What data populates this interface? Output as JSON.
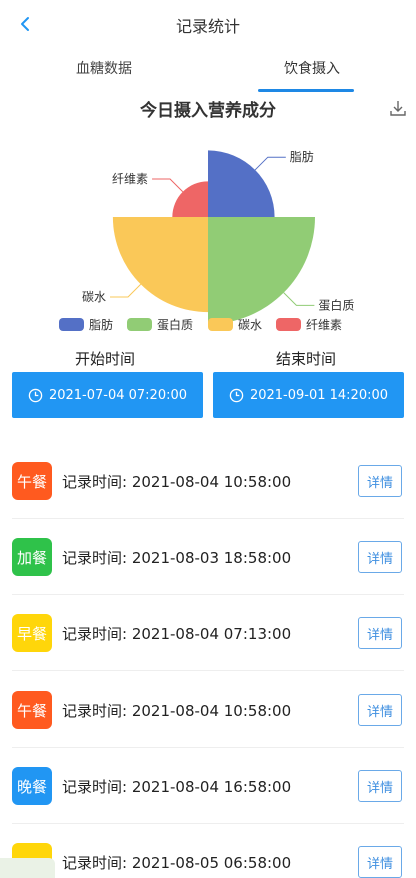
{
  "header": {
    "title": "记录统计"
  },
  "tabs": [
    {
      "label": "血糖数据"
    },
    {
      "label": "饮食摄入"
    }
  ],
  "chart_data": {
    "type": "pie",
    "variant": "rose",
    "title": "今日摄入营养成分",
    "legend_position": "bottom",
    "series": [
      {
        "name": "脂肪",
        "value": 28,
        "color": "#5470c6"
      },
      {
        "name": "蛋白质",
        "value": 45,
        "color": "#91cc75"
      },
      {
        "name": "碳水",
        "value": 40,
        "color": "#fac858"
      },
      {
        "name": "纤维素",
        "value": 15,
        "color": "#ee6666"
      }
    ]
  },
  "range": {
    "start_label": "开始时间",
    "end_label": "结束时间",
    "start_value": "2021-07-04 07:20:00",
    "end_value": "2021-09-01 14:20:00"
  },
  "records": [
    {
      "meal": "午餐",
      "color": "#ff5a1f",
      "text": "记录时间: 2021-08-04 10:58:00",
      "detail": "详情"
    },
    {
      "meal": "加餐",
      "color": "#2fc24a",
      "text": "记录时间: 2021-08-03 18:58:00",
      "detail": "详情"
    },
    {
      "meal": "早餐",
      "color": "#ffd60a",
      "text": "记录时间: 2021-08-04 07:13:00",
      "detail": "详情"
    },
    {
      "meal": "午餐",
      "color": "#ff5a1f",
      "text": "记录时间: 2021-08-04 10:58:00",
      "detail": "详情"
    },
    {
      "meal": "晚餐",
      "color": "#2196f3",
      "text": "记录时间: 2021-08-04 16:58:00",
      "detail": "详情"
    },
    {
      "meal": "",
      "color": "#ffd60a",
      "text": "记录时间: 2021-08-05 06:58:00",
      "detail": "详情"
    }
  ]
}
